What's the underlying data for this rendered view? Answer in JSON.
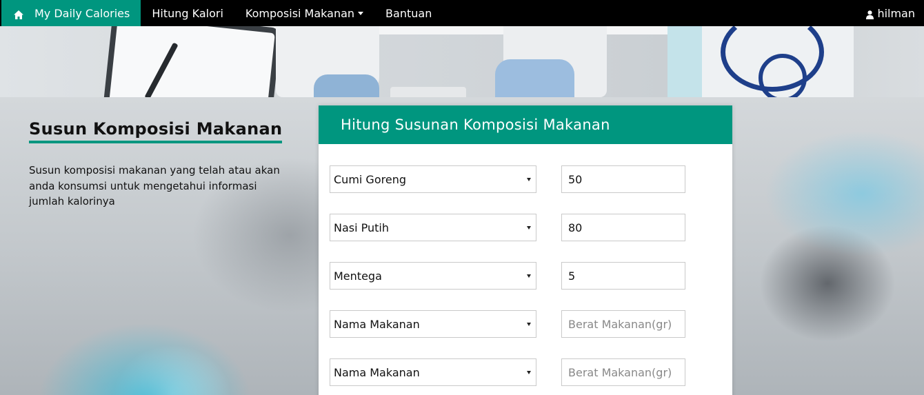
{
  "navbar": {
    "brand_label": "My Daily Calories",
    "items": [
      {
        "label": "Hitung Kalori"
      },
      {
        "label": "Komposisi Makanan"
      },
      {
        "label": "Bantuan"
      }
    ],
    "user_label": "hilman"
  },
  "intro": {
    "title": "Susun Komposisi Makanan",
    "description": "Susun komposisi makanan yang telah atau akan anda konsumsi untuk mengetahui informasi jumlah kalorinya"
  },
  "card": {
    "title": "Hitung Susunan Komposisi Makanan",
    "rows": [
      {
        "food": "Cumi Goreng",
        "weight": "50",
        "weight_placeholder": "Berat Makanan(gr)"
      },
      {
        "food": "Nasi Putih",
        "weight": "80",
        "weight_placeholder": "Berat Makanan(gr)"
      },
      {
        "food": "Mentega",
        "weight": "5",
        "weight_placeholder": "Berat Makanan(gr)"
      },
      {
        "food": "Nama Makanan",
        "weight": "",
        "weight_placeholder": "Berat Makanan(gr)"
      },
      {
        "food": "Nama Makanan",
        "weight": "",
        "weight_placeholder": "Berat Makanan(gr)"
      }
    ]
  },
  "colors": {
    "accent": "#00967f",
    "navbar_bg": "#000000"
  },
  "icons": {
    "brand": "home-icon",
    "user": "user-icon",
    "dropdown": "caret-down-icon"
  }
}
